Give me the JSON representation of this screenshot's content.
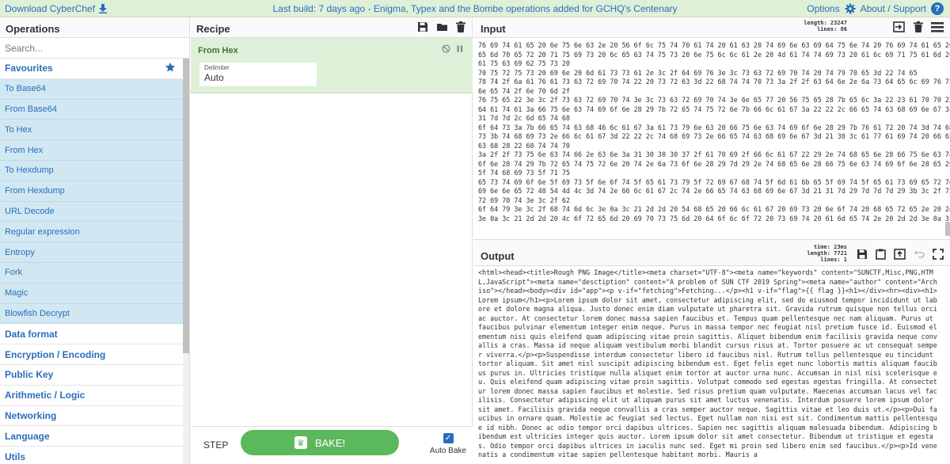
{
  "banner": {
    "download": "Download CyberChef",
    "build": "Last build: 7 days ago - Enigma, Typex and the Bombe operations added for GCHQ's Centenary",
    "options": "Options",
    "about": "About / Support"
  },
  "operations": {
    "title": "Operations",
    "search_placeholder": "Search...",
    "favourites": "Favourites",
    "favourite_ops": [
      "To Base64",
      "From Base64",
      "To Hex",
      "From Hex",
      "To Hexdump",
      "From Hexdump",
      "URL Decode",
      "Regular expression",
      "Entropy",
      "Fork",
      "Magic",
      "Blowfish Decrypt"
    ],
    "categories": [
      "Data format",
      "Encryption / Encoding",
      "Public Key",
      "Arithmetic / Logic",
      "Networking",
      "Language",
      "Utils"
    ]
  },
  "recipe": {
    "title": "Recipe",
    "op_name": "From Hex",
    "delimiter_label": "Delimiter",
    "delimiter_value": "Auto",
    "step": "STEP",
    "bake": "BAKE!",
    "auto_bake": "Auto Bake"
  },
  "input": {
    "title": "Input",
    "length_label": "length: 23247",
    "lines_label": "lines:    86",
    "lines": [
      "76 69 74 61 65 20 6e 75 6e 63 2e 20 56 6f 6c 75 74 70 61 74 20 61 63 20 74 69 6e 63 69 64 75 6e 74 20 76 69 74 61 65 20 73",
      "65 6d 70 65 72 20 71 75 69 73 20 6c 65 63 74 75 73 20 6e 75 6c 6c 61 2e 20 4d 61 74 74 69 73 20 61 6c 69 71 75 61 6d 20 66",
      "61 75 63 69 62 75 73 20",
      "70 75 72 75 73 20 69 6e 20 6d 61 73 73 61 2e 3c 2f 64 69 76 3e 3c 73 63 72 69 70 74 20 74 79 70 65 3d 22 74 65",
      "78 74 2f 6a 61 76 61 73 63 72 69 70 74 22 20 73 72 63 3d 22 68 74 74 70 73 3a 2f 2f 63 64 6e 2e 6a 73 64 65 6c 69 76 72 2e",
      "6e 65 74 2f 6e 70 6d 2f",
      "76 75 65 22 3e 3c 2f 73 63 72 69 70 74 3e 3c 73 63 72 69 70 74 3e 6e 65 77 20 56 75 65 28 7b 65 6c 3a 22 23 61 70 70 22 2c",
      "64 61 74 61 3a 66 75 6e 63 74 69 6f 6e 28 29 7b 72 65 74 75 72 6e 7b 66 6c 61 67 3a 22 22 2c 66 65 74 63 68 69 6e 67 3a 21",
      "31 7d 7d 2c 6d 65 74 68",
      "6f 64 73 3a 7b 66 65 74 63 68 46 6c 61 67 3a 61 73 79 6e 63 20 66 75 6e 63 74 69 6f 6e 28 29 7b 76 61 72 20 74 3d 74 68 69",
      "73 3b 74 68 69 73 2e 66 6c 61 67 3d 22 22 2c 74 68 69 73 2e 66 65 74 63 68 69 6e 67 3d 21 30 3c 61 77 61 69 74 20 66 65 74",
      "63 68 28 22 68 74 74 70",
      "3a 2f 2f 73 75 6e 63 74 66 2e 63 6e 3a 31 30 30 30 37 2f 61 70 69 2f 66 6c 61 67 22 29 2e 74 68 65 6e 28 66 75 6e 63 74 69",
      "6f 6e 28 74 29 7b 72 65 74 75 72 6e 20 74 2e 6a 73 6f 6e 28 29 7d 29 2e 74 68 65 6e 28 66 75 6e 63 74 69 6f 6e 28 65 29 7b",
      "5f 74 68 69 73 5f 71 75",
      "65 73 74 69 6f 6e 5f 69 73 5f 6e 6f 74 5f 65 61 73 79 5f 72 69 67 68 74 5f 6d 61 6b 65 5f 69 74 5f 65 61 73 69 65 72 7d 22",
      "69 6e 6e 65 72 48 54 4d 4c 3d 74 2e 66 6c 61 67 2c 74 2e 66 65 74 63 68 69 6e 67 3d 21 31 7d 29 7d 7d 7d 29 3b 3c 2f 73 63",
      "72 69 70 74 3e 3c 2f 62",
      "6f 64 79 3e 3c 2f 68 74 6d 6c 3e 0a 3c 21 2d 2d 20 54 68 65 20 66 6c 61 67 20 69 73 20 6e 6f 74 20 68 65 72 65 2e 20 2d 2d",
      "3e 0a 3c 21 2d 2d 20 4c 6f 72 65 6d 20 69 70 73 75 6d 20 64 6f 6c 6f 72 20 73 69 74 20 61 6d 65 74 2e 20 2d 2d 3e 0a 3c 3e"
    ]
  },
  "output": {
    "title": "Output",
    "time_label": "time: 23ms",
    "length_label": "length: 7721",
    "lines_label": "lines:     1",
    "text": "<html><head><title>Rough PNG Image</title><meta charset=\"UTF-8\"><meta name=\"keywords\" content=\"SUNCTF,Misc,PNG,HTML,JavaScript\"><meta name=\"desctiption\" content=\"A problem of SUN CTF 2019 Spring\"><meta name=\"author\" content=\"Archiso\"></head><body><div id=\"app\"><p v-if=\"fetching\">Fetching...</p><h1 v-if=\"flag\">{{ flag }}<h1></div><hr><div><h1>Lorem ipsum</h1><p>Lorem ipsum dolor sit amet, consectetur adipiscing elit, sed do eiusmod tempor incididunt ut labore et dolore magna aliqua. Justo donec enim diam vulputate ut pharetra sit. Gravida rutrum quisque non tellus orci ac auctor. At consectetur lorem donec massa sapien faucibus et. Tempus quam pellentesque nec nam aliquam. Purus ut faucibus pulvinar elementum integer enim neque. Purus in massa tempor nec feugiat nisl pretium fusce id. Euismod elementum nisi quis eleifend quam adipiscing vitae proin sagittis. Aliquet bibendum enim facilisis gravida neque convallis a cras. Massa id neque aliquam vestibulum morbi blandit cursus risus at. Tortor posuere ac ut consequat semper viverra.</p><p>Suspendisse interdum consectetur libero id faucibus nisl. Rutrum tellus pellentesque eu tincidunt tortor aliquam. Sit amet nisl suscipit adipiscing bibendum est. Eget felis eget nunc lobortis mattis aliquam faucibus purus in. Ultricies tristique nulla aliquet enim tortor at auctor urna nunc. Accumsan in nisl nisi scelerisque eu. Quis eleifend quam adipiscing vitae proin sagittis. Volutpat commodo sed egestas egestas fringilla. At consectetur lorem donec massa sapien faucibus et molestie. Sed risus pretium quam vulputate. Maecenas accumsan lacus vel facilisis. Consectetur adipiscing elit ut aliquam purus sit amet luctus venenatis. Interdum posuere lorem ipsum dolor sit amet. Facilisis gravida neque convallis a cras semper auctor neque. Sagittis vitae et leo duis ut.</p><p>Dui faucibus in ornare quam. Molestie ac feugiat sed lectus. Eget nullam non nisi est sit. Condimentum mattis pellentesque id nibh. Donec ac odio tempor orci dapibus ultrices. Sapien nec sagittis aliquam malesuada bibendum. Adipiscing bibendum est ultricies integer quis auctor. Lorem ipsum dolor sit amet consectetur. Bibendum ut tristique et egestas. Odio tempor orci dapibus ultrices in iaculis nunc sed. Eget mi proin sed libero enim sed faucibus.</p><p>Id venenatis a condimentum vitae sapien pellentesque habitant morbi. Mauris a"
  },
  "colors": {
    "accent": "#2a6ebb",
    "success": "#5cb85c",
    "favourite_bg": "#d1e8f3",
    "banner_bg": "#dff0d8"
  }
}
